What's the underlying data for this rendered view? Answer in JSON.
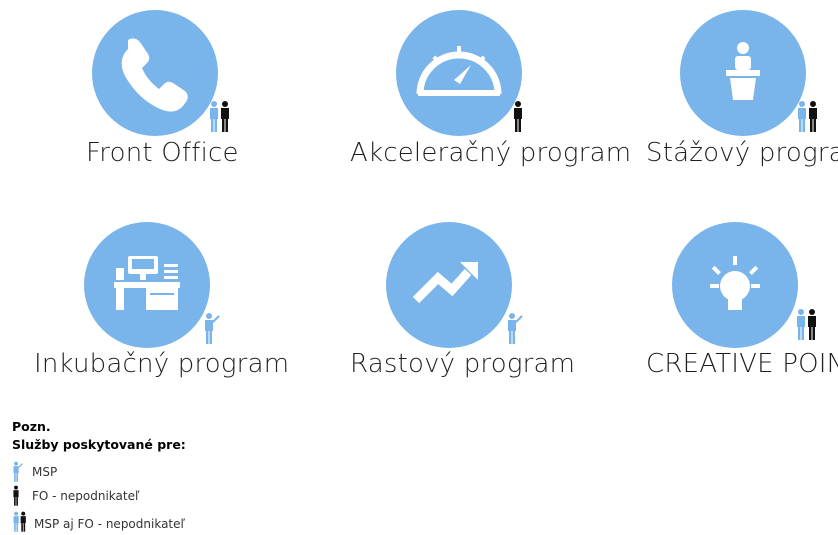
{
  "services": [
    {
      "label": "Front Office",
      "icon": "phone-icon",
      "audience": "msp-fo-icon"
    },
    {
      "label": "Akceleračný program",
      "icon": "speedometer-icon",
      "audience": "fo-icon"
    },
    {
      "label": "Stážový program",
      "icon": "speaker-podium-icon",
      "audience": "msp-fo-icon"
    },
    {
      "label": "Inkubačný program",
      "icon": "office-desk-icon",
      "audience": "msp-icon"
    },
    {
      "label": "Rastový program",
      "icon": "growth-arrow-icon",
      "audience": "msp-icon"
    },
    {
      "label": "CREATIVE POINT",
      "icon": "lightbulb-icon",
      "audience": "msp-fo-icon"
    }
  ],
  "note": {
    "title": "Pozn.",
    "subtitle": "Služby poskytované pre:",
    "legend": [
      {
        "icon": "msp-icon",
        "label": "MSP"
      },
      {
        "icon": "fo-icon",
        "label": "FO - nepodnikateľ"
      },
      {
        "icon": "msp-fo-icon",
        "label": "MSP aj FO - nepodnikateľ"
      }
    ]
  },
  "colors": {
    "circle": "#79b4ea",
    "msp": "#79b4ea",
    "fo": "#111111",
    "label": "#1f1f1f"
  }
}
